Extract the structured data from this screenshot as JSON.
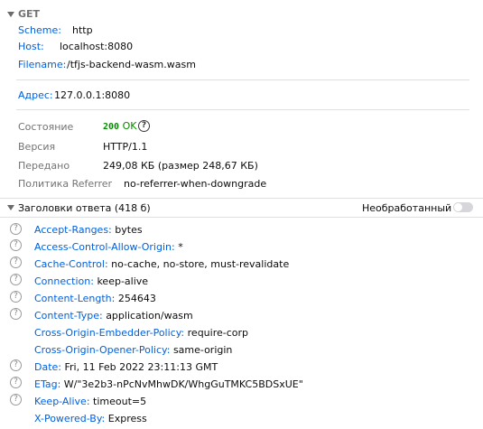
{
  "request": {
    "method": "GET",
    "scheme_label": "Scheme:",
    "scheme_value": "http",
    "host_label": "Host:",
    "host_value": "localhost:8080",
    "filename_label": "Filename:",
    "filename_value": "/tfjs-backend-wasm.wasm",
    "address_label": "Адрес:",
    "address_value": "127.0.0.1:8080"
  },
  "summary": {
    "status_label": "Состояние",
    "status_code": "200",
    "status_text": "OK",
    "version_label": "Версия",
    "version_value": "HTTP/1.1",
    "transferred_label": "Передано",
    "transferred_value": "249,08 КБ (размер 248,67 КБ)",
    "referrer_label": "Политика Referrer",
    "referrer_value": "no-referrer-when-downgrade"
  },
  "response_headers": {
    "title": "Заголовки ответа (418 б)",
    "raw_label": "Необработанный",
    "items": [
      {
        "name": "Accept-Ranges:",
        "value": "bytes"
      },
      {
        "name": "Access-Control-Allow-Origin:",
        "value": "*"
      },
      {
        "name": "Cache-Control:",
        "value": "no-cache, no-store, must-revalidate"
      },
      {
        "name": "Connection:",
        "value": "keep-alive"
      },
      {
        "name": "Content-Length:",
        "value": "254643"
      },
      {
        "name": "Content-Type:",
        "value": "application/wasm"
      },
      {
        "name": "Cross-Origin-Embedder-Policy:",
        "value": "require-corp"
      },
      {
        "name": "Cross-Origin-Opener-Policy:",
        "value": "same-origin"
      },
      {
        "name": "Date:",
        "value": "Fri, 11 Feb 2022 23:11:13 GMT"
      },
      {
        "name": "ETag:",
        "value": "W/\"3e2b3-nPcNvMhwDK/WhgGuTMKC5BDSxUE\""
      },
      {
        "name": "Keep-Alive:",
        "value": "timeout=5"
      },
      {
        "name": "X-Powered-By:",
        "value": "Express"
      }
    ]
  },
  "colors": {
    "link_blue": "#0060df",
    "status_green": "#058b00",
    "label_gray": "#737373"
  }
}
